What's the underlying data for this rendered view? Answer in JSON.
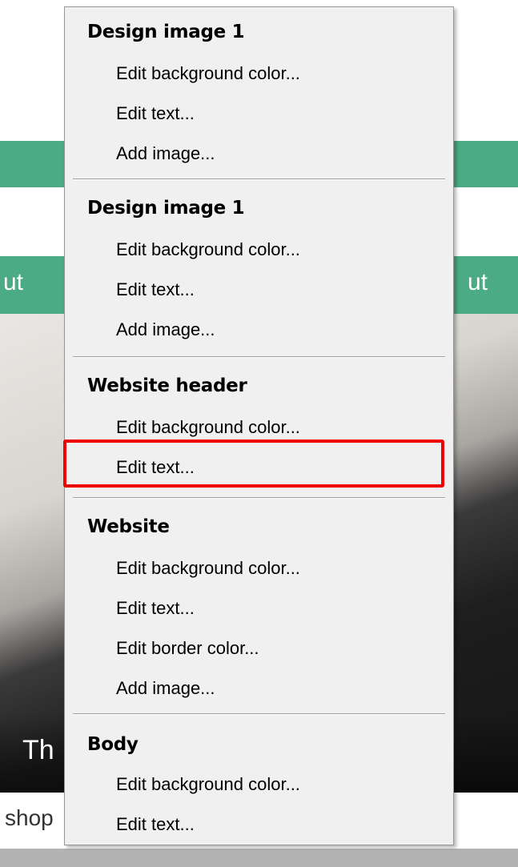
{
  "background": {
    "nav_left": "ut",
    "nav_right": "ut",
    "hero_text": "Th",
    "shop_text": "shop"
  },
  "menu": {
    "groups": [
      {
        "header": "Design image 1",
        "items": [
          "Edit background color...",
          "Edit text...",
          "Add image..."
        ]
      },
      {
        "header": "Design image 1",
        "items": [
          "Edit background color...",
          "Edit text...",
          "Add image..."
        ]
      },
      {
        "header": "Website header",
        "items": [
          "Edit background color...",
          "Edit text..."
        ]
      },
      {
        "header": "Website",
        "items": [
          "Edit background color...",
          "Edit text...",
          "Edit border color...",
          "Add image..."
        ]
      },
      {
        "header": "Body",
        "items": [
          "Edit background color...",
          "Edit text..."
        ]
      }
    ]
  },
  "colors": {
    "accent_green": "#4aab84",
    "highlight_red": "#ef0000",
    "menu_bg": "#f0f0f0"
  }
}
